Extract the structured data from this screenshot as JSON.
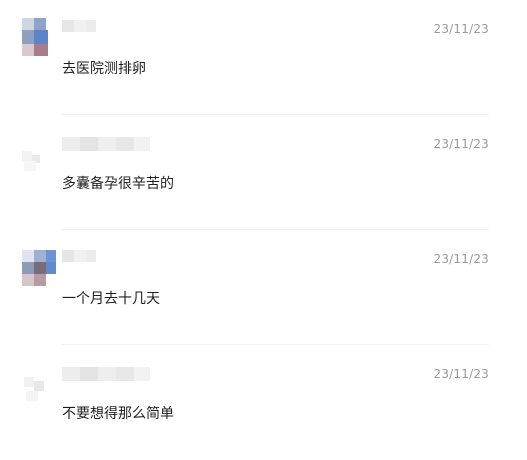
{
  "comments": [
    {
      "text": "去医院测排卵",
      "date": "23/11/23",
      "avatar": "pixelated-avatar",
      "username": ""
    },
    {
      "text": "多囊备孕很辛苦的",
      "date": "23/11/23",
      "avatar": "pixelated-avatar",
      "username": ""
    },
    {
      "text": "一个月去十几天",
      "date": "23/11/23",
      "avatar": "pixelated-avatar",
      "username": ""
    },
    {
      "text": "不要想得那么简单",
      "date": "23/11/23",
      "avatar": "pixelated-avatar",
      "username": ""
    }
  ]
}
